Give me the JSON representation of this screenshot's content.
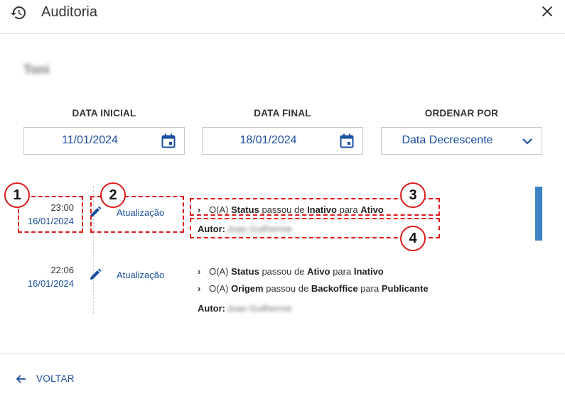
{
  "header": {
    "title": "Auditoria"
  },
  "user": {
    "name": "Toni"
  },
  "filters": {
    "start_label": "DATA INICIAL",
    "start_value": "11/01/2024",
    "end_label": "DATA FINAL",
    "end_value": "18/01/2024",
    "order_label": "ORDENAR POR",
    "order_value": "Data Decrescente"
  },
  "entries": [
    {
      "time": "23:00",
      "date": "16/01/2024",
      "action": "Atualização",
      "changes": [
        {
          "prefix": "O(A)",
          "field": "Status",
          "mid": "passou de",
          "from": "Inativo",
          "conj": "para",
          "to": "Ativo"
        }
      ],
      "author_label": "Autor:",
      "author_name": "Joao Guilherme"
    },
    {
      "time": "22:06",
      "date": "16/01/2024",
      "action": "Atualização",
      "changes": [
        {
          "prefix": "O(A)",
          "field": "Status",
          "mid": "passou de",
          "from": "Ativo",
          "conj": "para",
          "to": "Inativo"
        },
        {
          "prefix": "O(A)",
          "field": "Origem",
          "mid": "passou de",
          "from": "Backoffice",
          "conj": "para",
          "to": "Publicante"
        }
      ],
      "author_label": "Autor:",
      "author_name": "Joao Guilherme"
    }
  ],
  "annotations": [
    "1",
    "2",
    "3",
    "4"
  ],
  "footer": {
    "back_label": "VOLTAR"
  },
  "colors": {
    "accent": "#1a4fa0",
    "annotation": "#e01919",
    "scrollbar": "#3d82c4"
  }
}
